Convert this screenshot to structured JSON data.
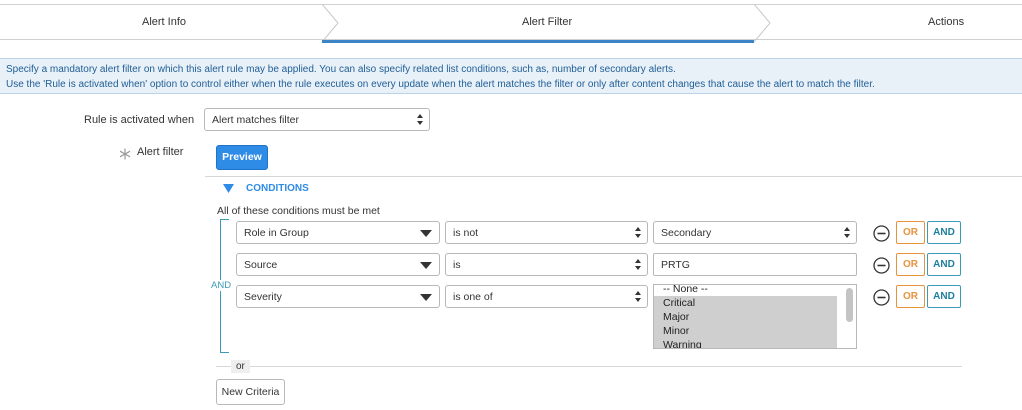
{
  "wizard": {
    "steps": [
      "Alert Info",
      "Alert Filter",
      "Actions"
    ],
    "active_index": 1
  },
  "banner": {
    "line1": "Specify a mandatory alert filter on which this alert rule may be applied. You can also specify related list conditions, such as, number of secondary alerts.",
    "line2": "Use the 'Rule is activated when' option to control either when the rule executes on every update when the alert matches the filter or only after content changes that cause the alert to match the filter."
  },
  "form": {
    "rule_label": "Rule is activated when",
    "rule_value": "Alert matches filter",
    "filter_label": "Alert filter",
    "preview_label": "Preview"
  },
  "conditions": {
    "header": "CONDITIONS",
    "subtitle": "All of these conditions must be met",
    "and_label": "AND",
    "rows": [
      {
        "field": "Role in Group",
        "operator": "is not",
        "value": "Secondary",
        "value_type": "select"
      },
      {
        "field": "Source",
        "operator": "is",
        "value": "PRTG",
        "value_type": "text"
      },
      {
        "field": "Severity",
        "operator": "is one of",
        "value_type": "list",
        "options": [
          "-- None --",
          "Critical",
          "Major",
          "Minor",
          "Warning"
        ],
        "selected": [
          "Critical",
          "Major",
          "Minor",
          "Warning"
        ]
      }
    ],
    "or_button": "OR",
    "and_button": "AND",
    "or_separator": "or",
    "new_criteria": "New Criteria"
  },
  "colors": {
    "accent": "#2e8be6",
    "or": "#e8923c",
    "and": "#3b9ab8",
    "banner_bg": "#e9f1f8"
  }
}
